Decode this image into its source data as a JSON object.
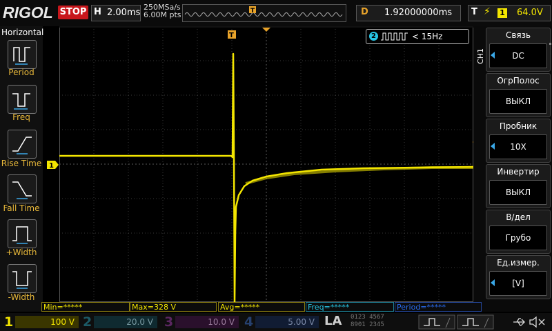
{
  "header": {
    "logo": "RIGOL",
    "run_state": "STOP",
    "horizontal_key": "H",
    "timebase": "2.00ms",
    "sample_rate": "250MSa/s",
    "memory_depth": "6.00M pts",
    "delay_key": "D",
    "delay": "1.92000000ms",
    "trigger_key": "T",
    "trigger_source": "1",
    "trigger_level": "64.0V"
  },
  "left_panel": {
    "title": "Horizontal",
    "items": [
      {
        "label": "Period"
      },
      {
        "label": "Freq"
      },
      {
        "label": "Rise Time"
      },
      {
        "label": "Fall Time"
      },
      {
        "label": "+Width"
      },
      {
        "label": "-Width"
      }
    ]
  },
  "counter": {
    "channel": "2",
    "value": "< 15Hz"
  },
  "markers": {
    "ch1": "1",
    "trigger": "T"
  },
  "right_menu": {
    "channel": "CH1",
    "items": [
      {
        "title": "Связь",
        "value": "DC"
      },
      {
        "title": "ОгрПолос",
        "value": "ВЫКЛ"
      },
      {
        "title": "Пробник",
        "value": "10X"
      },
      {
        "title": "Инвертир",
        "value": "ВЫКЛ"
      },
      {
        "title": "В/дел",
        "value": "Грубо"
      },
      {
        "title": "Ед.измер.",
        "value": "[V]"
      }
    ]
  },
  "measurements": {
    "min": "Min=*****",
    "max": "Max=328 V",
    "avg": "Avg=*****",
    "freq": "Freq=*****",
    "period": "Period=*****"
  },
  "bottom": {
    "channels": [
      {
        "num": "1",
        "scale": "100 V",
        "color": "#f3e500"
      },
      {
        "num": "2",
        "scale": "20.0 V",
        "color": "#27c6e6"
      },
      {
        "num": "3",
        "scale": "10.0 V",
        "color": "#e040e0"
      },
      {
        "num": "4",
        "scale": "5.00 V",
        "color": "#2a6cf0"
      }
    ],
    "la_label": "LA",
    "la_digits_top": "0123 4567",
    "la_digits_bottom": "8901 2345"
  },
  "colors": {
    "ch1": "#f3e500",
    "accent": "#e8a32a",
    "menu_arrow": "#3aa8e8"
  }
}
